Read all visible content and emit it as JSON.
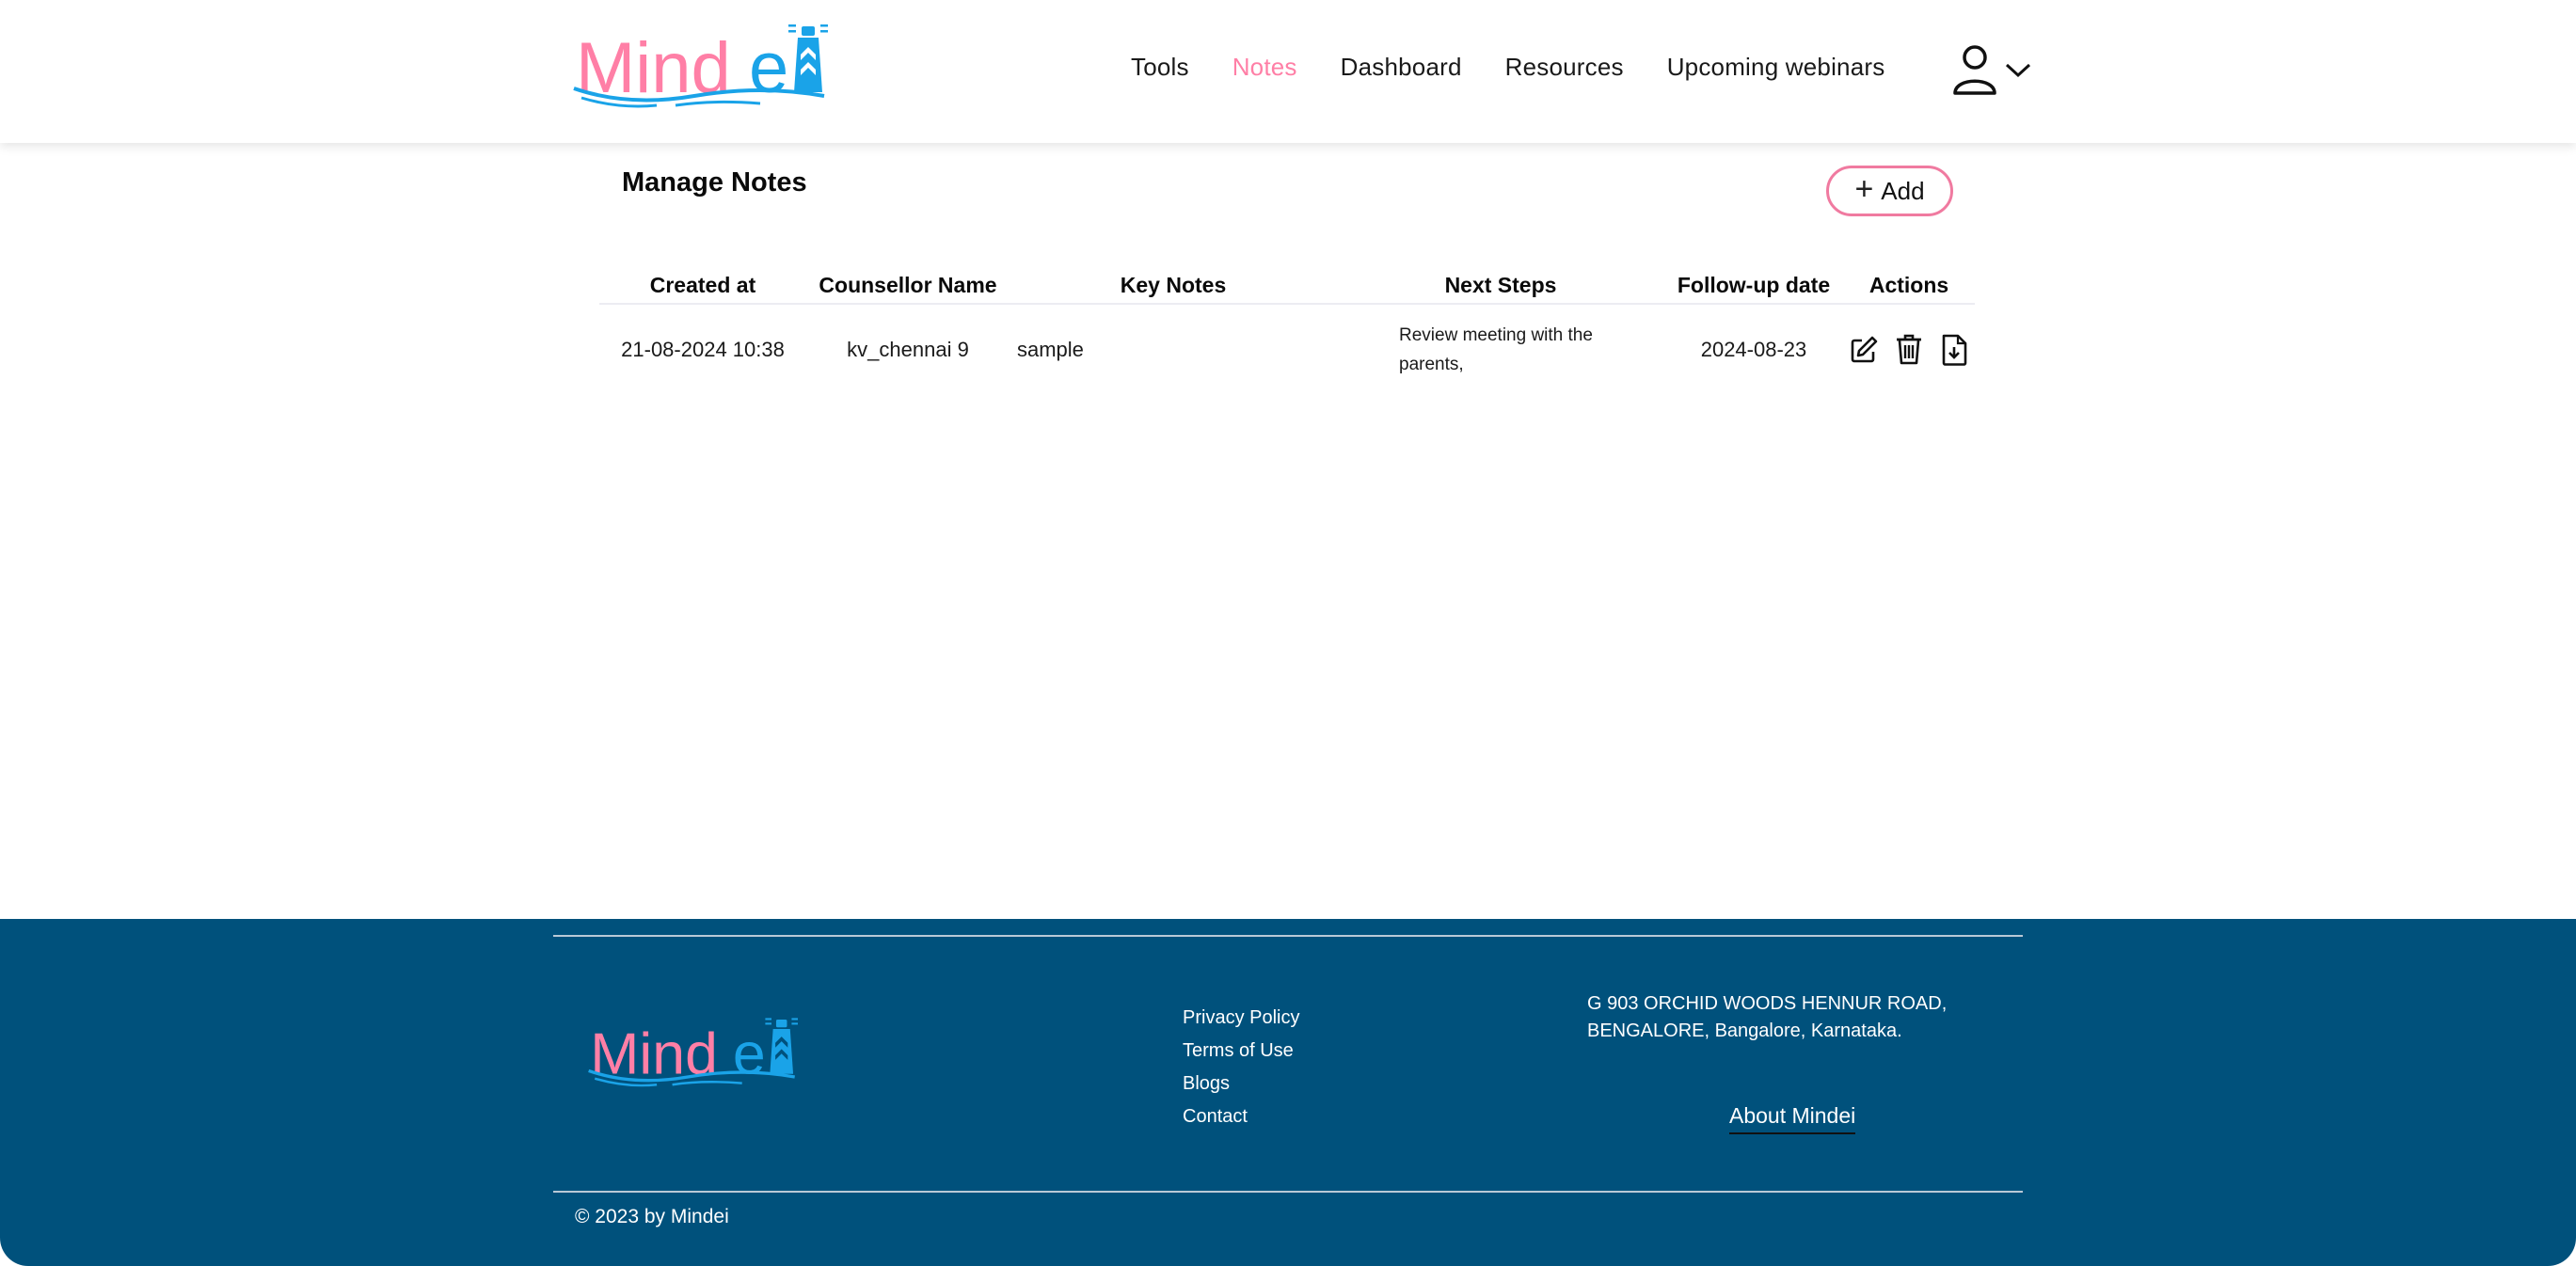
{
  "brand": {
    "name": "Mindei",
    "name_pink_part": "Mind",
    "name_blue_part": "e",
    "colors": {
      "pink": "#ff7fa6",
      "blue": "#1aa3e8",
      "footer_bg": "#00517c",
      "add_border": "#f07aa0"
    }
  },
  "nav": {
    "items": [
      {
        "label": "Tools",
        "active": false
      },
      {
        "label": "Notes",
        "active": true
      },
      {
        "label": "Dashboard",
        "active": false
      },
      {
        "label": "Resources",
        "active": false
      },
      {
        "label": "Upcoming webinars",
        "active": false
      }
    ],
    "user_icon": "user-icon",
    "dropdown_icon": "chevron-down-icon"
  },
  "main": {
    "title": "Manage Notes",
    "add_button": {
      "icon": "plus-icon",
      "label": "Add"
    },
    "table": {
      "columns": [
        "Created at",
        "Counsellor Name",
        "Key Notes",
        "Next Steps",
        "Follow-up date",
        "Actions"
      ],
      "rows": [
        {
          "created_at": "21-08-2024 10:38",
          "counsellor": "kv_chennai 9",
          "key_notes": "sample",
          "next_steps": "Review meeting with the parents,",
          "follow_up": "2024-08-23",
          "actions": [
            "edit-icon",
            "trash-icon",
            "file-download-icon"
          ]
        }
      ]
    }
  },
  "footer": {
    "links": [
      "Privacy Policy",
      "Terms of Use",
      "Blogs",
      "Contact"
    ],
    "address_line1": "G 903 ORCHID WOODS HENNUR ROAD,",
    "address_line2": "BENGALORE, Bangalore, Karnataka.",
    "about_link": "About Mindei",
    "copyright": "© 2023 by Mindei"
  }
}
